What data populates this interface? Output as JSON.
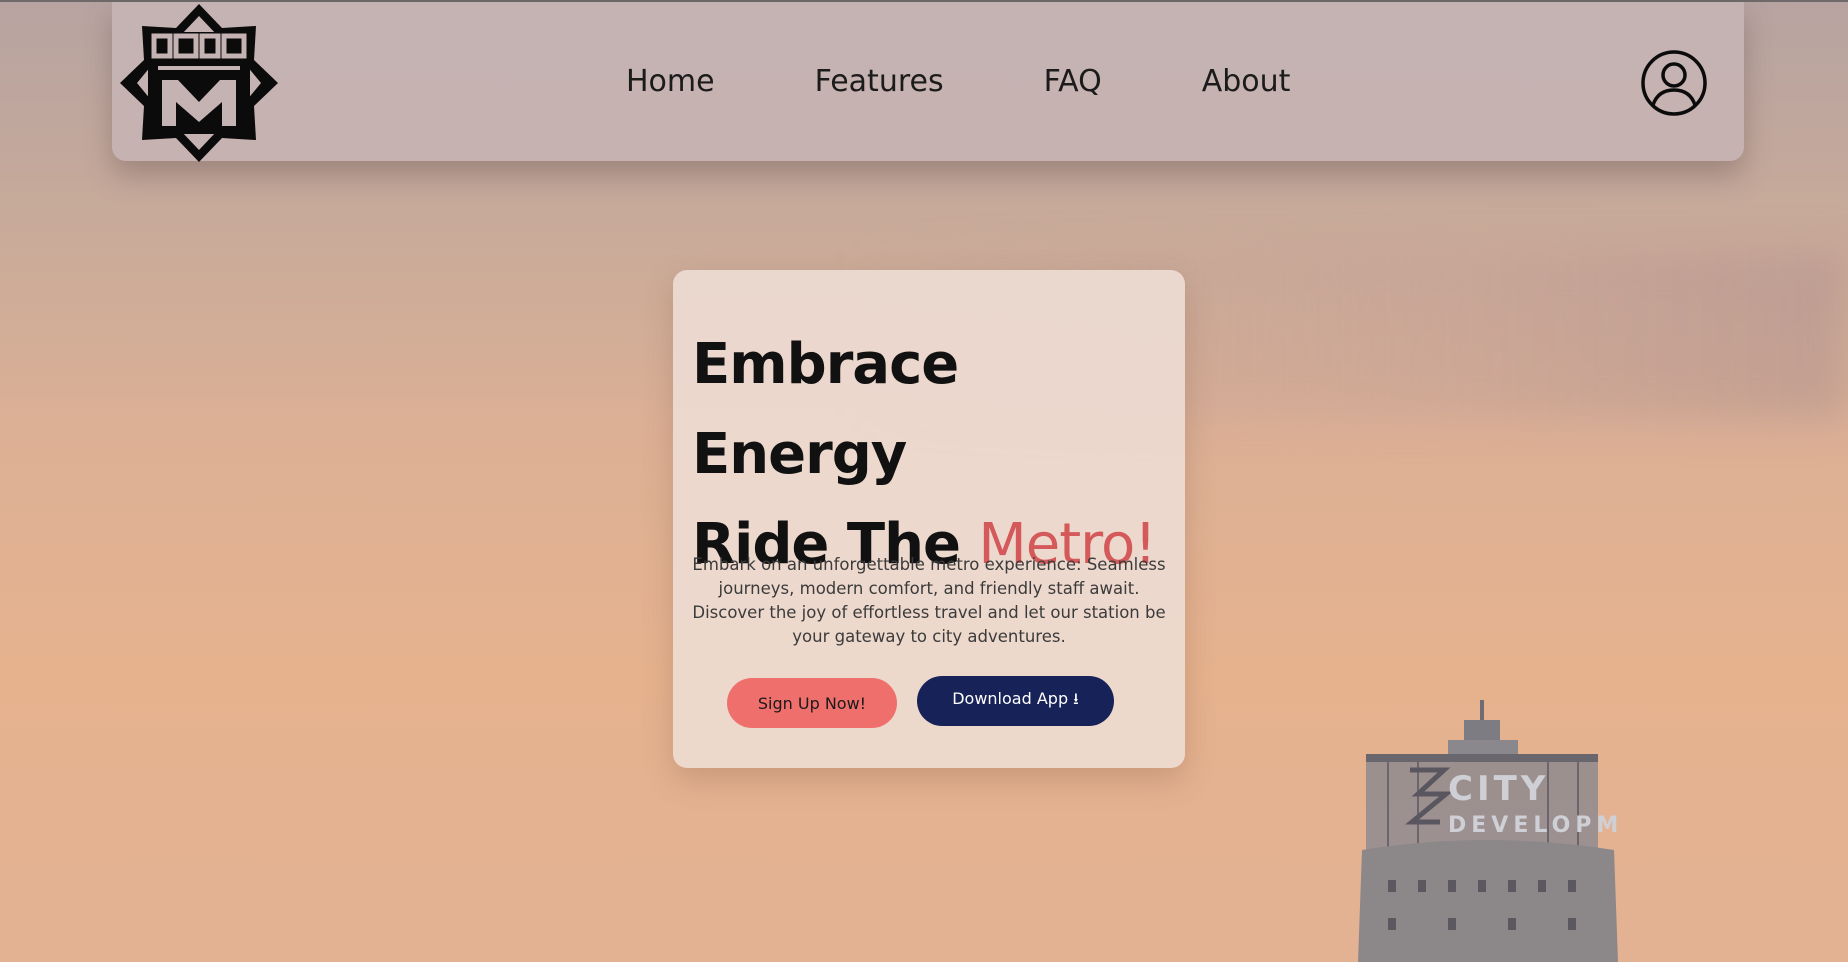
{
  "nav": {
    "links": [
      "Home",
      "Features",
      "FAQ",
      "About"
    ]
  },
  "hero": {
    "line1": "Embrace",
    "line2": "Energy",
    "line3_prefix": "Ride The ",
    "line3_accent": "Metro!",
    "description": "Embark on an unforgettable metro experience: Seamless journeys, modern comfort, and friendly staff await. Discover the joy of effortless travel and let our station be your gateway to city adventures.",
    "signup_label": "Sign Up Now!",
    "download_label": "Download App ⭳"
  },
  "tower": {
    "sign_line1": "CITY",
    "sign_line2": "DEVELOPM"
  },
  "colors": {
    "accent": "#d4595a",
    "signup_button": "#ef6f6c",
    "download_button": "#172258"
  }
}
